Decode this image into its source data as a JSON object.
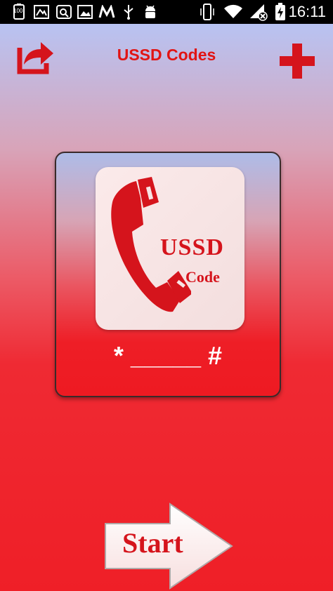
{
  "status_bar": {
    "time": "16:11",
    "battery_label": "100",
    "icons": [
      "battery-100-icon",
      "gallery-icon",
      "q-app-icon",
      "image-icon",
      "m-app-icon",
      "usb-icon",
      "android-debug-icon",
      "phone-vibrate-icon",
      "wifi-icon",
      "no-signal-icon",
      "battery-charging-icon"
    ]
  },
  "header": {
    "title": "USSD Codes",
    "share_icon": "share-icon",
    "add_icon": "add-icon"
  },
  "card": {
    "logo_title": "USSD",
    "logo_subtitle": "Code",
    "pattern": "* _____ #"
  },
  "start_button": {
    "label": "Start"
  },
  "colors": {
    "accent": "#e11414",
    "logo_bg": "#f7e4e4",
    "text_light": "#ffffff"
  }
}
